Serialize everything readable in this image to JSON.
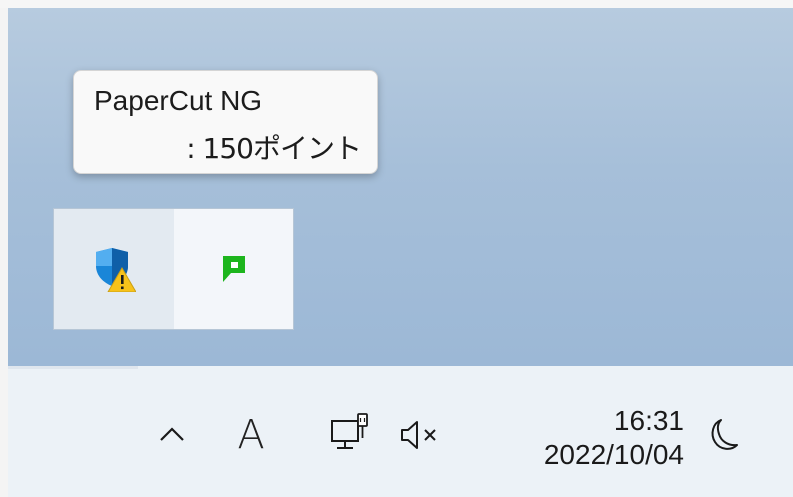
{
  "tooltip": {
    "app_name": "PaperCut NG",
    "balance_text": ": 150ポイント"
  },
  "tray_overflow": {
    "icons": [
      {
        "name": "windows-security-warning-icon"
      },
      {
        "name": "papercut-icon"
      }
    ]
  },
  "taskbar": {
    "ime_indicator": "A",
    "clock": {
      "time": "16:31",
      "date": "2022/10/04"
    }
  },
  "colors": {
    "desktop": "#a6bfd9",
    "taskbar": "#ecf2f7",
    "papercut_green": "#1db51d",
    "shield_blue": "#1a86d8",
    "warning_yellow": "#f7c21a"
  }
}
